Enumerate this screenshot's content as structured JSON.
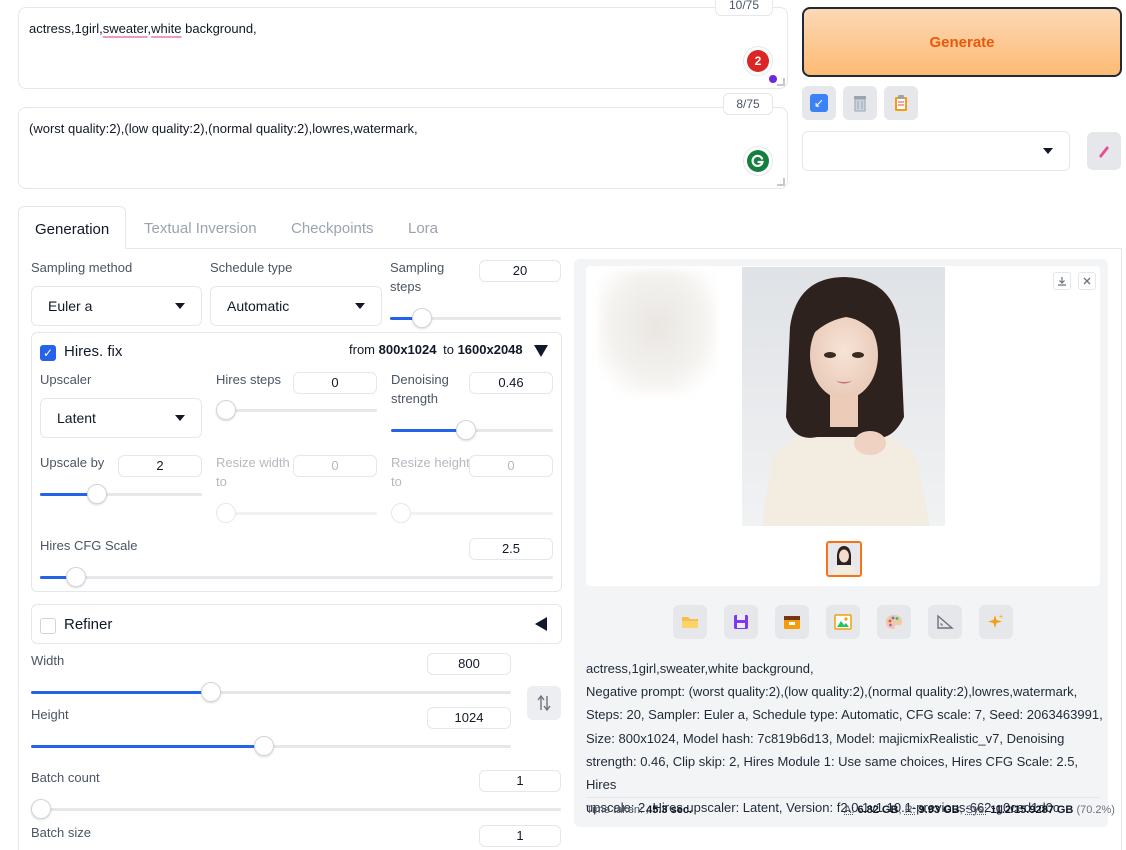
{
  "prompt": {
    "positive_prefix": "actress,1girl,",
    "positive_word1": "sweater",
    "positive_sep": ",",
    "positive_word2": "white",
    "positive_suffix": " background,",
    "positive_counter": "10/75",
    "badge_count": "2",
    "negative_text": "(worst quality:2),(low quality:2),(normal quality:2),lowres,watermark,",
    "negative_counter": "8/75"
  },
  "actions": {
    "generate_label": "Generate",
    "style_value": ""
  },
  "tabs": [
    {
      "label": "Generation"
    },
    {
      "label": "Textual Inversion"
    },
    {
      "label": "Checkpoints"
    },
    {
      "label": "Lora"
    }
  ],
  "generation": {
    "sampling_method_label": "Sampling method",
    "sampling_method_value": "Euler a",
    "schedule_type_label": "Schedule type",
    "schedule_type_value": "Automatic",
    "sampling_steps_label": "Sampling\nsteps",
    "sampling_steps_value": "20",
    "sampling_steps_fraction": 0.19,
    "hires": {
      "label": "Hires. fix",
      "checked": true,
      "from_word": "from",
      "from_size": "800x1024",
      "to_word": "to",
      "to_size": "1600x2048",
      "upscaler_label": "Upscaler",
      "upscaler_value": "Latent",
      "hires_steps_label": "Hires steps",
      "hires_steps_value": "0",
      "hires_steps_fraction": 0.0,
      "denoising_label": "Denoising\nstrength",
      "denoising_value": "0.46",
      "denoising_fraction": 0.46,
      "upscale_by_label": "Upscale by",
      "upscale_by_value": "2",
      "upscale_by_fraction": 0.35,
      "resize_width_label": "Resize width\nto",
      "resize_width_value": "0",
      "resize_height_label": "Resize height\nto",
      "resize_height_value": "0",
      "hires_cfg_label": "Hires CFG Scale",
      "hires_cfg_value": "2.5",
      "hires_cfg_fraction": 0.07
    },
    "refiner_label": "Refiner",
    "refiner_checked": false,
    "width_label": "Width",
    "width_value": "800",
    "width_fraction": 0.375,
    "height_label": "Height",
    "height_value": "1024",
    "height_fraction": 0.485,
    "batch_count_label": "Batch count",
    "batch_count_value": "1",
    "batch_size_label": "Batch size",
    "batch_size_value": "1"
  },
  "output": {
    "info_lines": [
      "actress,1girl,sweater,white background,",
      "Negative prompt: (worst quality:2),(low quality:2),(normal quality:2),lowres,watermark,",
      "Steps: 20, Sampler: Euler a, Schedule type: Automatic, CFG scale: 7, Seed: 2063463991,",
      "Size: 800x1024, Model hash: 7c819b6d13, Model: majicmixRealistic_v7, Denoising",
      "strength: 0.46, Clip skip: 2, Hires Module 1: Use same choices, Hires CFG Scale: 2.5, Hires",
      "upscale: 2, Hires upscaler: Latent, Version: f2.0.1v1.10.1-previous-662-g0ced1d0c"
    ],
    "time_label": "Time taken:",
    "time_value": "45.3 sec.",
    "mem_a_label": "A:",
    "mem_a_value": "6.82 GB",
    "mem_r_label": "R:",
    "mem_r_value": "9.93 GB",
    "mem_sys_label": "Sys:",
    "mem_sys_value": "11.2/15.9287 GB",
    "mem_pct": "(70.2%)"
  },
  "icons": {
    "apply": "arrow-icon",
    "trash": "trash-icon",
    "clipboard": "clipboard-icon",
    "edit": "pencil-icon",
    "swap": "swap-icon",
    "download": "download-icon",
    "close": "close-icon",
    "folder": "folder-icon",
    "save": "save-icon",
    "zip": "zip-icon",
    "img2img": "image-icon",
    "inpaint": "palette-icon",
    "extras": "ruler-icon",
    "upscale": "sparkle-icon"
  },
  "colors": {
    "accent": "#2563eb",
    "generate_text": "#ea580c",
    "generate_bg": "#fdba74"
  }
}
